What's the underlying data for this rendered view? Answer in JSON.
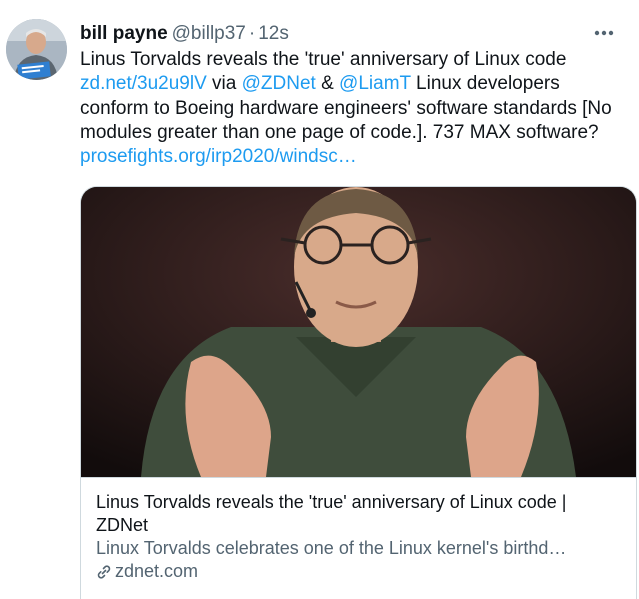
{
  "tweet": {
    "author": {
      "display_name": "bill payne",
      "handle": "@billp37",
      "separator": "·",
      "time": "12s",
      "avatar_icon": "user-avatar"
    },
    "more_icon": "more-horizontal-icon",
    "text": {
      "p1": "Linus Torvalds reveals the 'true' anniversary of Linux code ",
      "link1": "zd.net/3u2u9lV",
      "p2": " via ",
      "mention1": "@ZDNet",
      "p3": " & ",
      "mention2": "@LiamT",
      "p4": " Linux developers conform to Boeing hardware engineers' software standards [No modules greater than one page of code.]. 737 MAX software? ",
      "link2": "prosefights.org/irp2020/windsc…"
    },
    "card": {
      "title": "Linus Torvalds reveals the 'true' anniversary of Linux code | ZDNet",
      "description": "Linux Torvalds celebrates one of the Linux kernel's birthd…",
      "domain": "zdnet.com",
      "link_icon": "link-icon"
    }
  },
  "colors": {
    "accent": "#1d9bf0",
    "text": "#0f1419",
    "secondary": "#536471",
    "border": "#cfd9de"
  }
}
